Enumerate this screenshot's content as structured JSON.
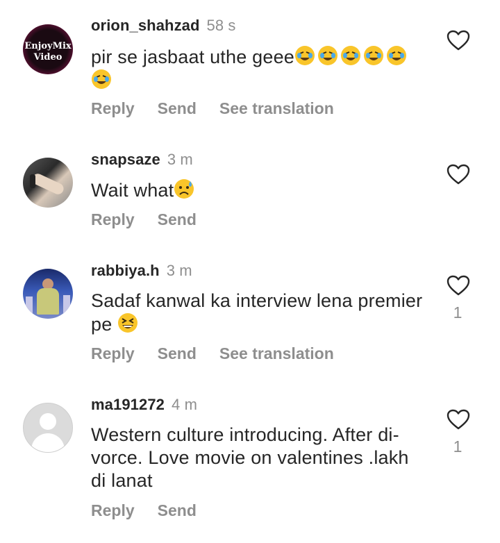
{
  "comments": [
    {
      "username": "orion_shahzad",
      "time": "58 s",
      "text": "pir se jasbaat uthe geee",
      "emoji_row1": [
        "rofl-emoji",
        "rofl-emoji",
        "rofl-emoji",
        "rofl-emoji",
        "rofl-emoji"
      ],
      "emoji_row2": [
        "rofl-emoji"
      ],
      "actions": [
        "Reply",
        "Send",
        "See translation"
      ],
      "likes": "",
      "avatar_text": [
        "EnjoyMix",
        "Video"
      ]
    },
    {
      "username": "snapsaze",
      "time": "3 m",
      "text": "Wait what",
      "emoji": "sad-sweat-emoji",
      "actions": [
        "Reply",
        "Send"
      ],
      "likes": ""
    },
    {
      "username": "rabbiya.h",
      "time": "3 m",
      "text_line1": "Sadaf kanwal ka interview lena premier",
      "text_line2": "pe",
      "emoji": "grinning-squint-emoji",
      "actions": [
        "Reply",
        "Send",
        "See translation"
      ],
      "likes": "1"
    },
    {
      "username": "ma191272",
      "time": "4 m",
      "text_line1": "Western culture introducing.  After  di-",
      "text_line2": "vorce. Love  movie on valentines .lakh",
      "text_line3": "di lanat",
      "actions": [
        "Reply",
        "Send"
      ],
      "likes": "1"
    }
  ],
  "colors": {
    "text": "#262626",
    "secondary": "#8e8e8e",
    "emoji": "#f9c52a"
  }
}
